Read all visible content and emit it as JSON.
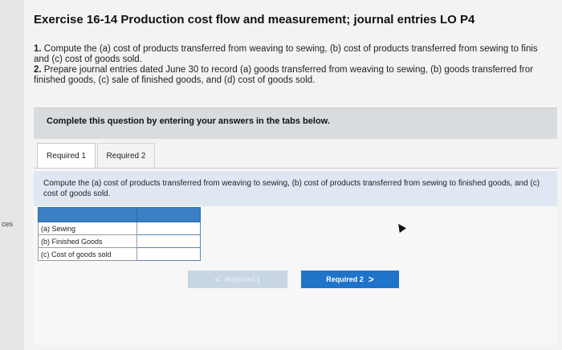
{
  "side": {
    "label": "ces"
  },
  "header": {
    "title": "Exercise 16-14 Production cost flow and measurement; journal entries LO P4"
  },
  "instructions": {
    "item1_num": "1.",
    "item1_line1": "Compute the (a) cost of products transferred from weaving to sewing, (b) cost of products transferred from sewing to finis",
    "item1_line2": "and (c) cost of goods sold.",
    "item2_num": "2.",
    "item2_line1": "Prepare journal entries dated June 30 to record (a) goods transferred from weaving to sewing, (b) goods transferred fror",
    "item2_line2": "finished goods, (c) sale of finished goods, and (d) cost of goods sold."
  },
  "banner": {
    "text": "Complete this question by entering your answers in the tabs below."
  },
  "tabs": [
    {
      "label": "Required 1"
    },
    {
      "label": "Required 2"
    }
  ],
  "prompt": {
    "text": "Compute the (a) cost of products transferred from weaving to sewing, (b) cost of products transferred from sewing to finished goods, and (c) cost of goods sold."
  },
  "table": {
    "rows": [
      {
        "label": "(a) Sewing",
        "value": ""
      },
      {
        "label": "(b) Finished Goods",
        "value": ""
      },
      {
        "label": "(c) Cost of goods sold",
        "value": ""
      }
    ]
  },
  "nav": {
    "prev_label": "Required 1",
    "next_label": "Required 2",
    "prev_chevron": "<",
    "next_chevron": ">"
  },
  "colors": {
    "accent": "#1f73c9",
    "table_header": "#3b7fc4",
    "prompt_bg": "#dfe8f2"
  }
}
